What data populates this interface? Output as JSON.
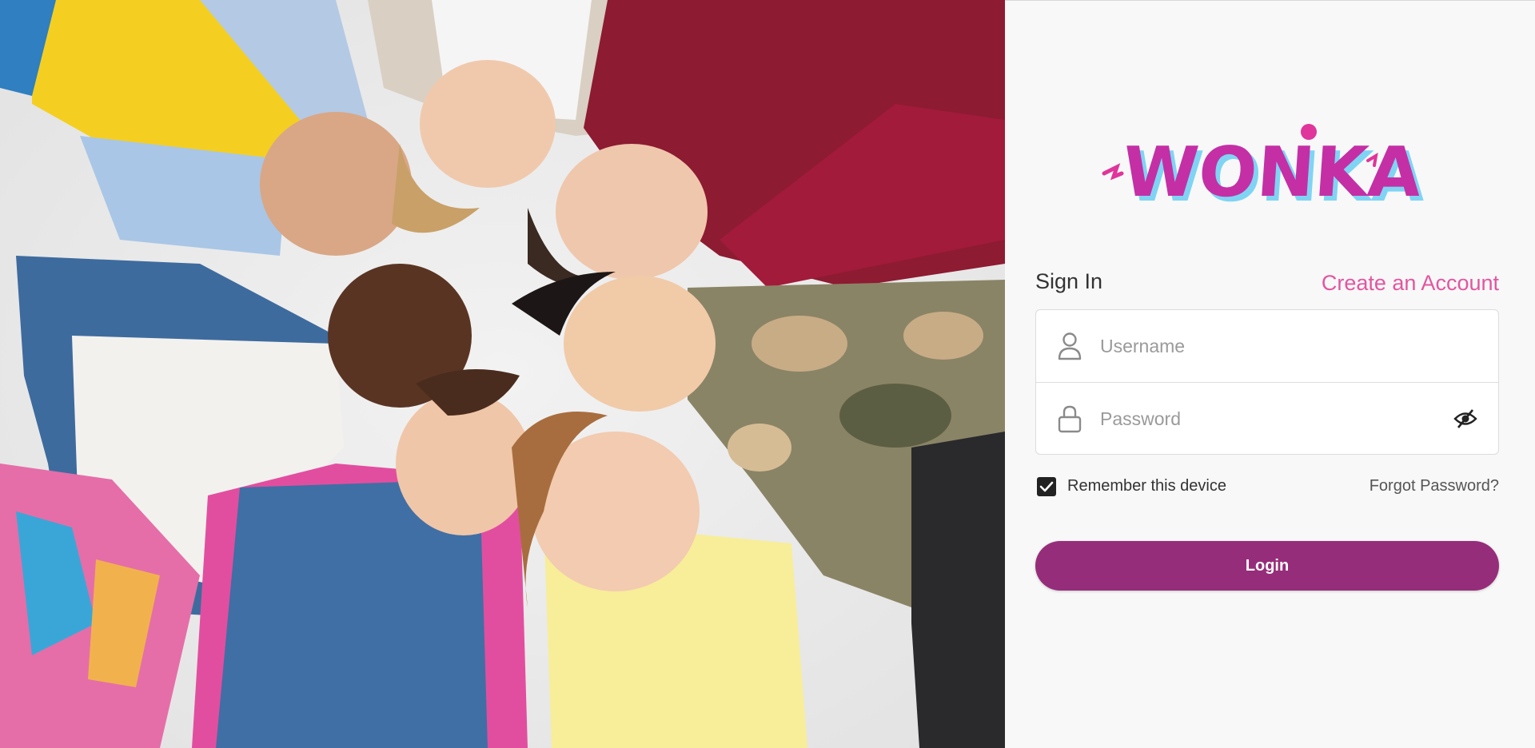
{
  "hero": {
    "description_icon": "children-photo-image"
  },
  "logo": {
    "text": "WONKA",
    "colors": {
      "fill": "#c42fa6",
      "shadow": "#7fd4f4",
      "accent": "#e0359a"
    }
  },
  "signin": {
    "title": "Sign In",
    "create_account_label": "Create an Account"
  },
  "form": {
    "username_placeholder": "Username",
    "password_placeholder": "Password",
    "username_icon": "user-icon",
    "password_icon": "lock-icon",
    "visibility_icon": "eye-slash-icon"
  },
  "options": {
    "remember_label": "Remember this device",
    "remember_checked": true,
    "forgot_label": "Forgot Password?"
  },
  "login_button": {
    "label": "Login",
    "color": "#962d7a"
  },
  "colors": {
    "link_pink": "#e4559f",
    "panel_bg": "#f8f8f8"
  }
}
